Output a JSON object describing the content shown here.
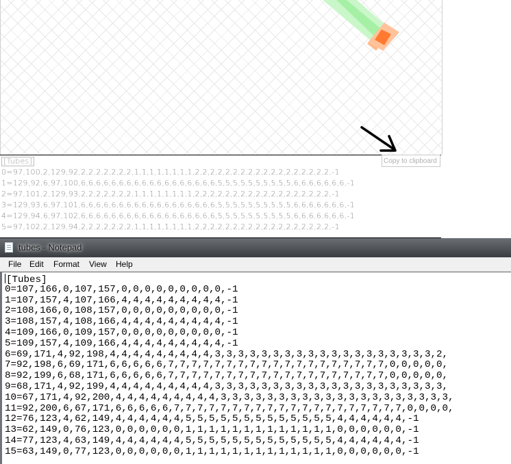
{
  "viewer": {
    "copy_button_label": "Copy to clipboard",
    "tubes_header": "[Tubes]",
    "lines": [
      "0=97,100,2,129,92,2,2,2,2,2,2,2,1,1,1,1,1,1,1,1,2,2,2,2,2,2,2,2,2,2,2,2,2,2,2,2,2,2,-1",
      "1=129,92,6,97,100,6,6,6,6,6,6,6,6,6,6,6,6,6,6,6,6,6,6,5,5,5,5,5,5,5,5,5,5,6,6,6,6,6,6,6,-1",
      "2=97,101,2,129,93,2,2,2,2,2,2,2,1,1,1,1,1,1,1,1,2,2,2,2,2,2,2,2,2,2,2,2,2,2,2,2,2,2,-1",
      "3=129,93,6,97,101,6,6,6,6,6,6,6,6,6,6,6,6,6,6,6,6,6,6,5,5,5,5,5,5,5,5,5,5,6,6,6,6,6,6,6,-1",
      "4=129,94,6,97,102,6,6,6,6,6,6,6,6,6,6,6,6,6,6,6,6,6,6,5,5,5,5,5,5,5,5,5,5,6,6,6,6,6,6,6,-1",
      "5=97,102,2,129,94,2,2,2,2,2,2,2,1,1,1,1,1,1,1,1,2,2,2,2,2,2,2,2,2,2,2,2,2,2,2,2,2,2,-1"
    ]
  },
  "notepad": {
    "title": "tubes - Notepad",
    "menu": [
      "File",
      "Edit",
      "Format",
      "View",
      "Help"
    ],
    "lines": [
      "[Tubes]",
      "0=107,166,0,107,157,0,0,0,0,0,0,0,0,0,-1",
      "1=107,157,4,107,166,4,4,4,4,4,4,4,4,4,-1",
      "2=108,166,0,108,157,0,0,0,0,0,0,0,0,0,-1",
      "3=108,157,4,108,166,4,4,4,4,4,4,4,4,4,-1",
      "4=109,166,0,109,157,0,0,0,0,0,0,0,0,0,-1",
      "5=109,157,4,109,166,4,4,4,4,4,4,4,4,4,-1",
      "6=69,171,4,92,198,4,4,4,4,4,4,4,4,4,3,3,3,3,3,3,3,3,3,3,3,3,3,3,3,3,3,3,3,2,",
      "7=92,198,6,69,171,6,6,6,6,6,7,7,7,7,7,7,7,7,7,7,7,7,7,7,7,7,7,7,7,0,0,0,0,0,",
      "8=92,199,6,68,171,6,6,6,6,6,7,7,7,7,7,7,7,7,7,7,7,7,7,7,7,7,7,7,7,0,0,0,0,0,",
      "9=68,171,4,92,199,4,4,4,4,4,4,4,4,4,3,3,3,3,3,3,3,3,3,3,3,3,3,3,3,3,3,3,3,3,",
      "10=67,171,4,92,200,4,4,4,4,4,4,4,4,4,3,3,3,3,3,3,3,3,3,3,3,3,3,3,3,3,3,3,3,3,",
      "11=92,200,6,67,171,6,6,6,6,6,7,7,7,7,7,7,7,7,7,7,7,7,7,7,7,7,7,7,7,7,0,0,0,0,",
      "12=76,123,4,62,149,4,4,4,4,4,4,5,5,5,5,5,5,5,5,5,5,5,5,5,4,4,4,4,4,4,-1",
      "13=62,149,0,76,123,0,0,0,0,0,0,1,1,1,1,1,1,1,1,1,1,1,1,1,0,0,0,0,0,0,-1",
      "14=77,123,4,63,149,4,4,4,4,4,4,5,5,5,5,5,5,5,5,5,5,5,5,5,4,4,4,4,4,4,-1",
      "15=63,149,0,77,123,0,0,0,0,0,0,1,1,1,1,1,1,1,1,1,1,1,1,1,0,0,0,0,0,0,-1"
    ]
  },
  "colors": {
    "tube_green": "#b8f5b8",
    "tube_green_dark": "#97ee97",
    "tube_orange": "#ffb07a",
    "tube_orange_dark": "#ff6a1a",
    "titlebar": "#4a4e53",
    "menubar": "#f0f0f0"
  }
}
